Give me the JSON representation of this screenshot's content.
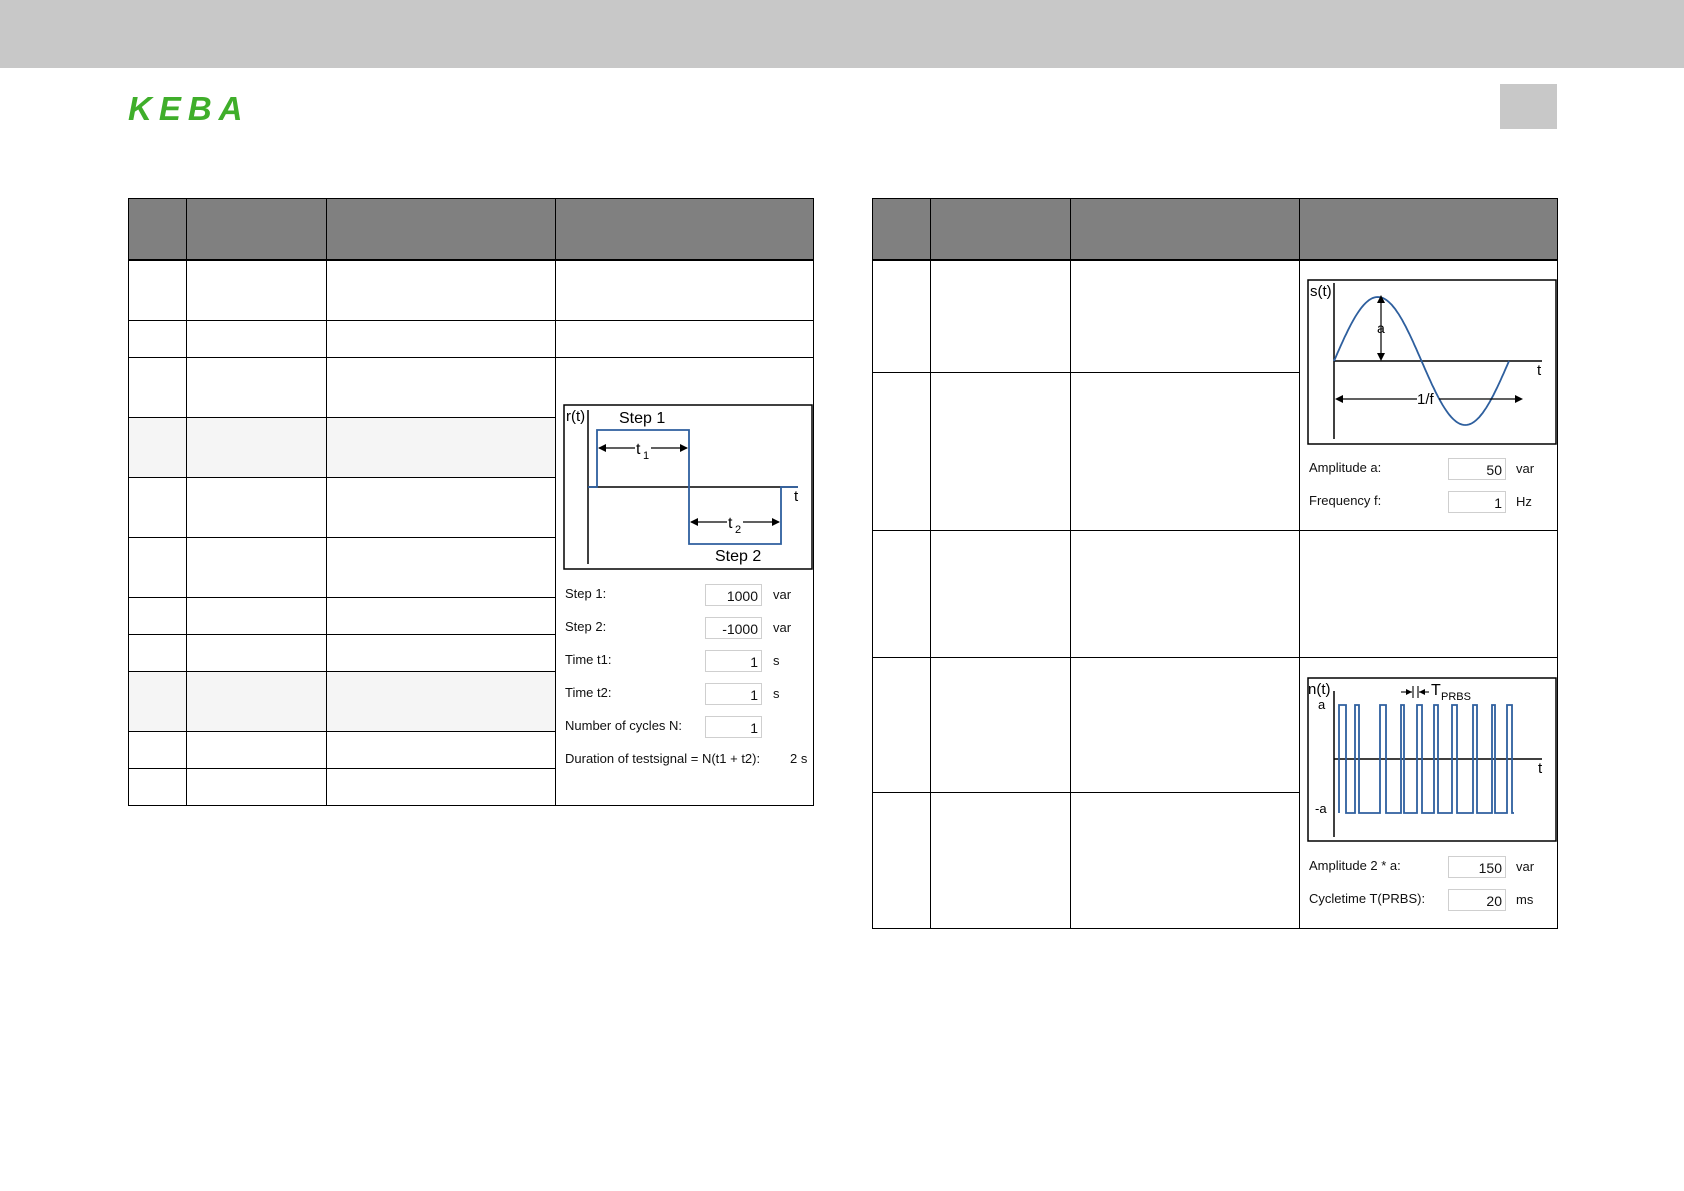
{
  "header": {
    "brand": "KEBA",
    "brand_color": "#3fae2a",
    "bar_color": "#c8c8c8"
  },
  "step_panel": {
    "diagram": {
      "axis_y": "r(t)",
      "axis_x": "t",
      "step1_label": "Step 1",
      "step2_label": "Step 2",
      "t1_label": "t",
      "t1_sub": "1",
      "t2_label": "t",
      "t2_sub": "2"
    },
    "fields": [
      {
        "label": "Step 1:",
        "value": "1000",
        "unit": "var"
      },
      {
        "label": "Step 2:",
        "value": "-1000",
        "unit": "var"
      },
      {
        "label": "Time t1:",
        "value": "1",
        "unit": "s"
      },
      {
        "label": "Time t2:",
        "value": "1",
        "unit": "s"
      },
      {
        "label": "Number of cycles N:",
        "value": "1",
        "unit": ""
      }
    ],
    "duration_label": "Duration of testsignal = N(t1 + t2):",
    "duration_value": "2 s"
  },
  "sine_panel": {
    "diagram": {
      "axis_y": "s(t)",
      "axis_x": "t",
      "amp_label": "a",
      "period_label": "1/f"
    },
    "fields": [
      {
        "label": "Amplitude a:",
        "value": "50",
        "unit": "var"
      },
      {
        "label": "Frequency f:",
        "value": "1",
        "unit": "Hz"
      }
    ]
  },
  "prbs_panel": {
    "diagram": {
      "axis_y": "n(t)",
      "axis_x": "t",
      "top_label": "a",
      "bottom_label": "-a",
      "period_label": "T",
      "period_sub": "PRBS"
    },
    "fields": [
      {
        "label": "Amplitude 2 * a:",
        "value": "150",
        "unit": "var"
      },
      {
        "label": "Cycletime T(PRBS):",
        "value": "20",
        "unit": "ms"
      }
    ]
  },
  "signal_color": "#2e5f9e"
}
